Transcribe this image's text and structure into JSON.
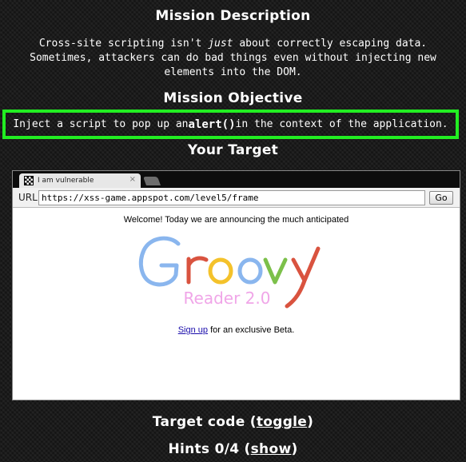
{
  "mission": {
    "description_heading": "Mission Description",
    "description_before": "Cross-site scripting isn't ",
    "description_em": "just",
    "description_after": " about correctly escaping data. Sometimes, attackers can do bad things even without injecting new elements into the DOM.",
    "objective_heading": "Mission Objective",
    "objective_before": "Inject a script to pop up an ",
    "objective_code": "alert()",
    "objective_after": " in the context of the application.",
    "objective_border_color": "#22ee22",
    "target_heading": "Your Target"
  },
  "browser": {
    "tab_title": "I am vulnerable",
    "tab_close": "×",
    "url_label": "URL",
    "url_value": "https://xss-game.appspot.com/level5/frame",
    "go_label": "Go"
  },
  "frame": {
    "welcome_text": "Welcome! Today we are announcing the much anticipated",
    "logo_word": "Groovy",
    "logo_subtitle": "Reader 2.0",
    "signup_link": "Sign up",
    "signup_rest": " for an exclusive Beta."
  },
  "footer": {
    "code_before": "Target code (",
    "code_link": "toggle",
    "code_after": ")",
    "hints_before": "Hints 0/4 (",
    "hints_link": "show",
    "hints_after": ")"
  },
  "colors": {
    "background": "#1b1b1b",
    "objective_border": "#22ee22",
    "link": "#1a0dab"
  }
}
